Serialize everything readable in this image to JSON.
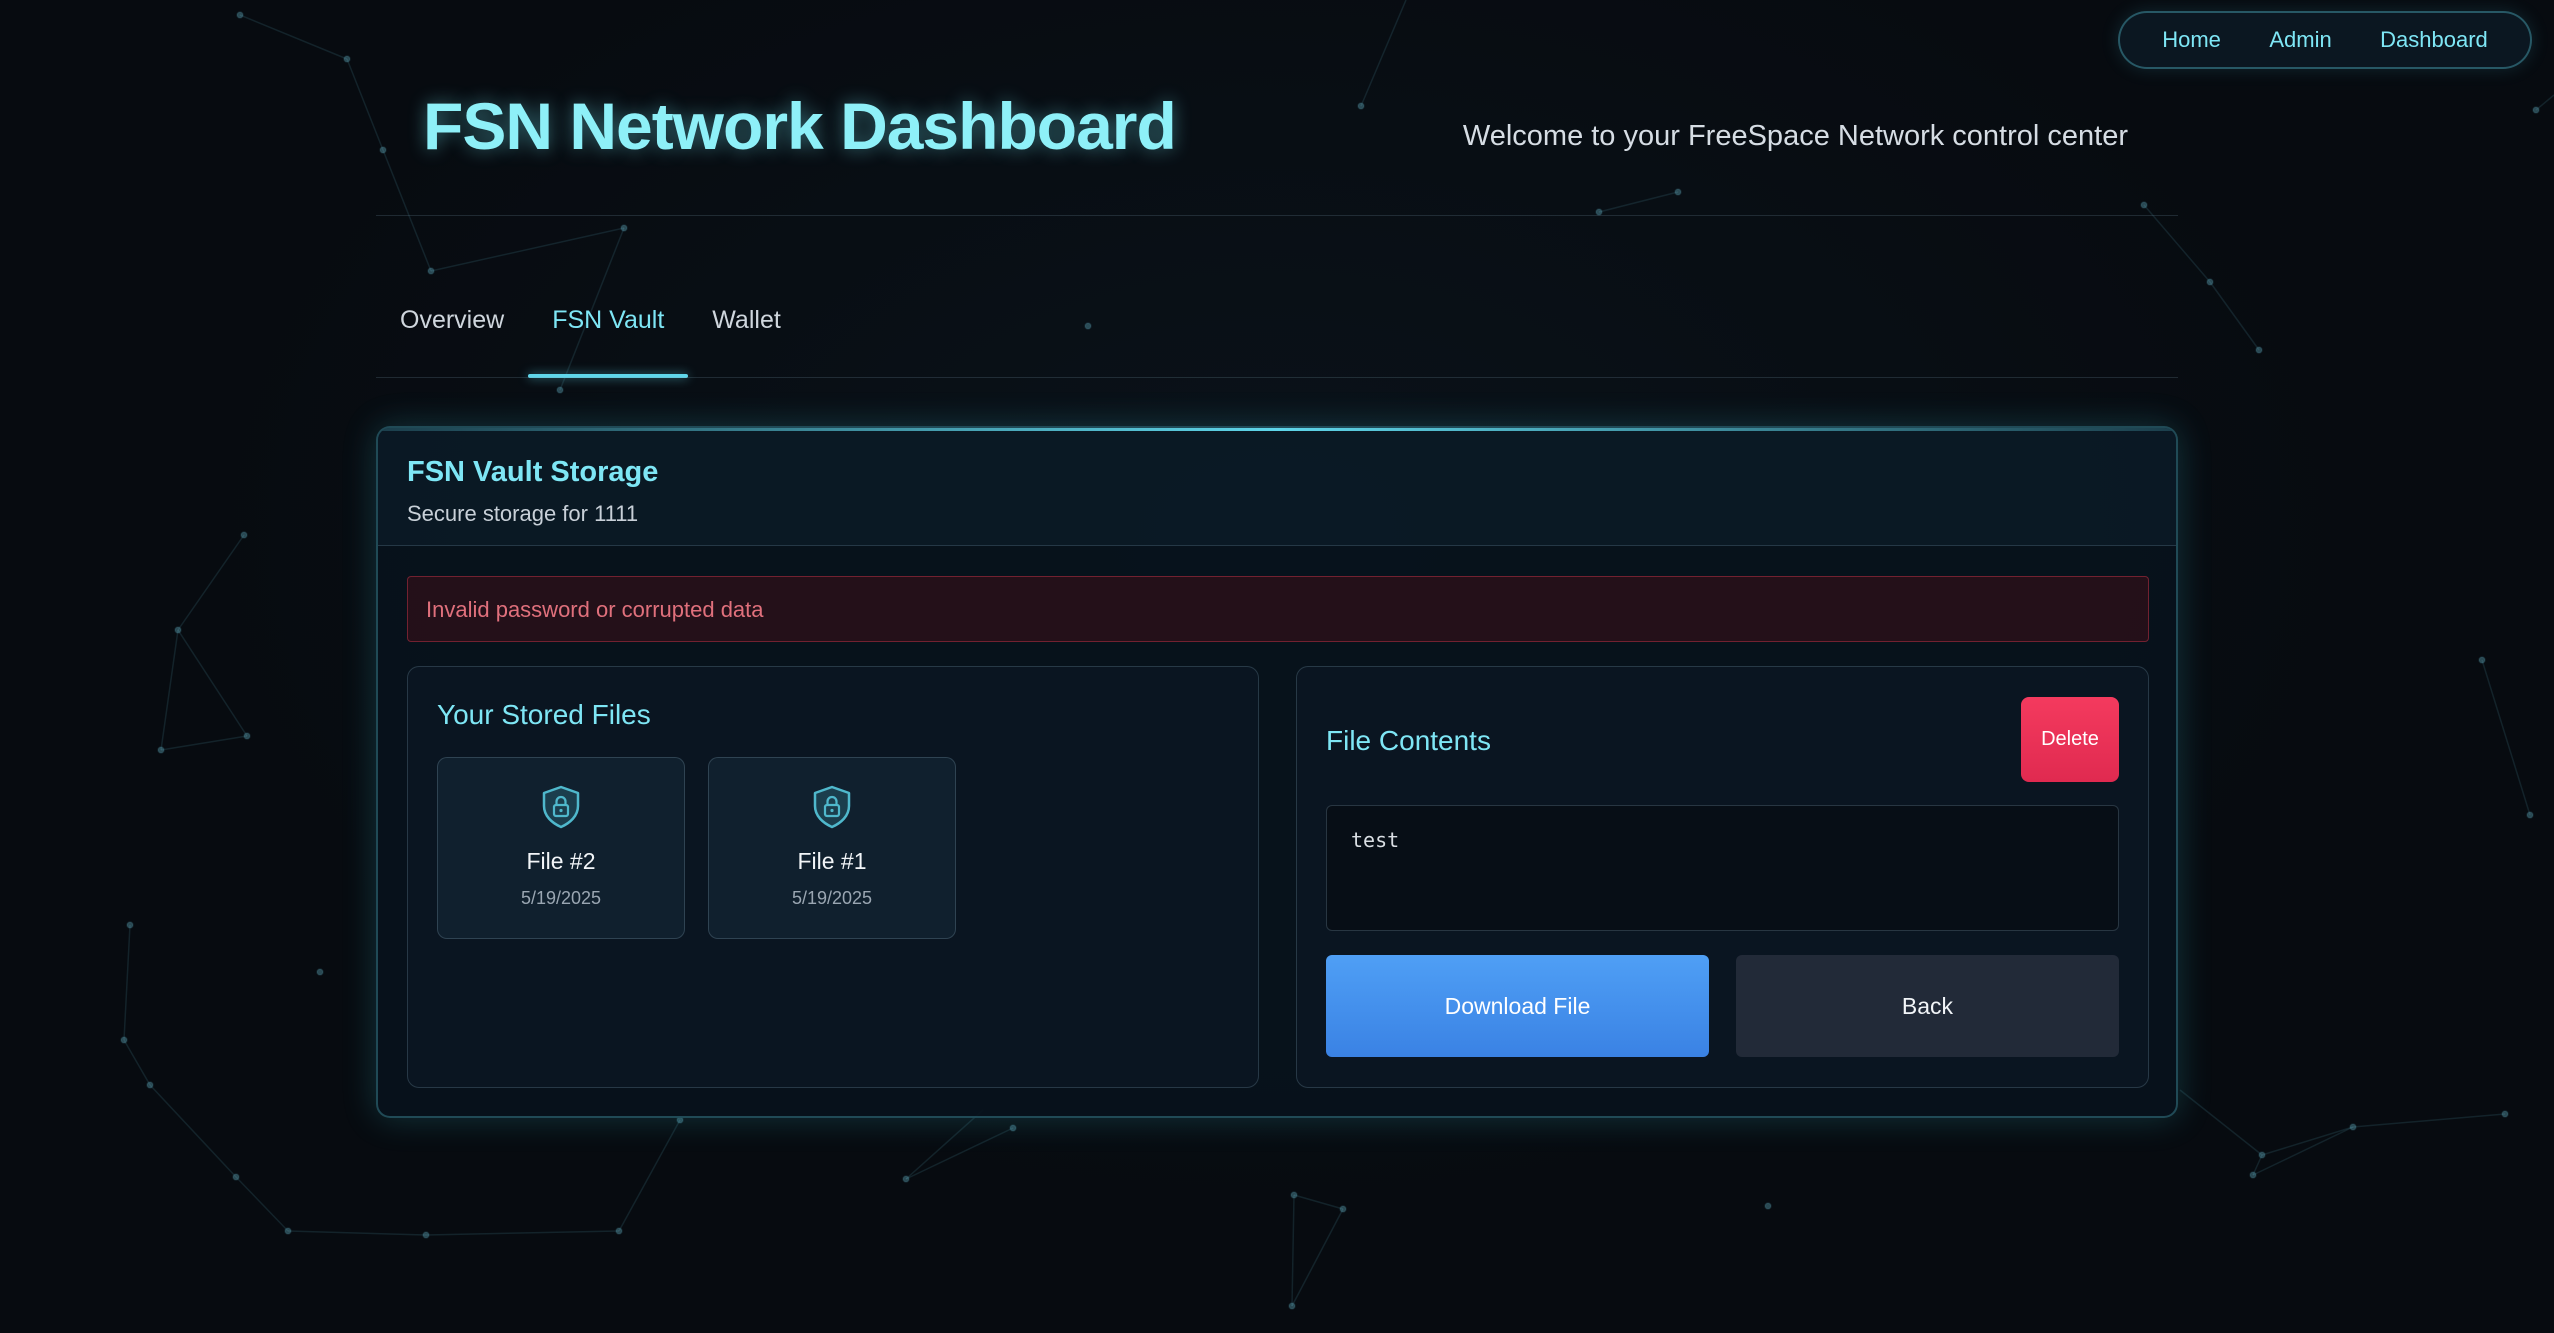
{
  "nav": {
    "items": [
      {
        "label": "Home"
      },
      {
        "label": "Admin"
      },
      {
        "label": "Dashboard"
      }
    ]
  },
  "header": {
    "title": "FSN Network Dashboard",
    "welcome": "Welcome to your FreeSpace Network control center"
  },
  "tabs": [
    {
      "label": "Overview",
      "active": false
    },
    {
      "label": "FSN Vault",
      "active": true
    },
    {
      "label": "Wallet",
      "active": false
    }
  ],
  "vault": {
    "title": "FSN Vault Storage",
    "subtitle": "Secure storage for 1111",
    "error": "Invalid password or corrupted data",
    "files_panel": {
      "title": "Your Stored Files",
      "files": [
        {
          "name": "File #2",
          "date": "5/19/2025",
          "icon": "shield-lock-icon"
        },
        {
          "name": "File #1",
          "date": "5/19/2025",
          "icon": "shield-lock-icon"
        }
      ]
    },
    "contents_panel": {
      "title": "File Contents",
      "delete_label": "Delete",
      "content": "test",
      "download_label": "Download File",
      "back_label": "Back"
    }
  },
  "colors": {
    "accent": "#7ee6f5",
    "background": "#070b10",
    "error": "#e0707c",
    "delete": "#f43a5e",
    "download": "#4f9ff5"
  }
}
